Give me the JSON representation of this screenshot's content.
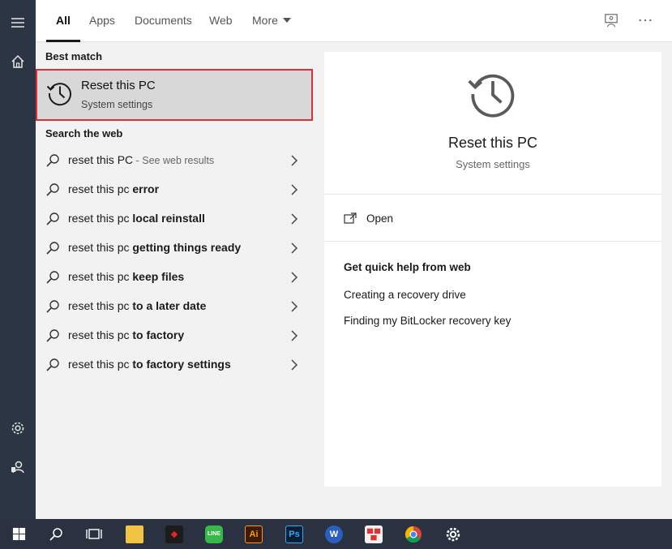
{
  "tabs": [
    {
      "label": "All",
      "active": true
    },
    {
      "label": "Apps",
      "active": false
    },
    {
      "label": "Documents",
      "active": false
    },
    {
      "label": "Web",
      "active": false
    },
    {
      "label": "More",
      "active": false
    }
  ],
  "top_icons": [
    "feedback-icon",
    "more-options-icon"
  ],
  "results": {
    "best_match_heading": "Best match",
    "best_match": {
      "title": "Reset this PC",
      "subtitle": "System settings",
      "icon": "history-icon"
    },
    "web_heading": "Search the web",
    "web_items": [
      {
        "prefix": "reset this PC",
        "bold": "",
        "hint": " - See web results"
      },
      {
        "prefix": "reset this pc ",
        "bold": "error",
        "hint": ""
      },
      {
        "prefix": "reset this pc ",
        "bold": "local reinstall",
        "hint": ""
      },
      {
        "prefix": "reset this pc ",
        "bold": "getting things ready",
        "hint": ""
      },
      {
        "prefix": "reset this pc ",
        "bold": "keep files",
        "hint": ""
      },
      {
        "prefix": "reset this pc ",
        "bold": "to a later date",
        "hint": ""
      },
      {
        "prefix": "reset this pc ",
        "bold": "to factory",
        "hint": ""
      },
      {
        "prefix": "reset this pc ",
        "bold": "to factory settings",
        "hint": ""
      }
    ]
  },
  "preview": {
    "title": "Reset this PC",
    "subtitle": "System settings",
    "open_label": "Open",
    "help_heading": "Get quick help from web",
    "links": [
      "Creating a recovery drive",
      "Finding my BitLocker recovery key"
    ]
  },
  "search": {
    "value": "reset this PC"
  },
  "left_rail": [
    "menu-icon",
    "home-icon",
    "settings-icon",
    "user-icon"
  ],
  "taskbar": {
    "items": [
      {
        "name": "start-icon"
      },
      {
        "name": "search-icon"
      },
      {
        "name": "task-view-icon"
      },
      {
        "name": "file-explorer-icon"
      },
      {
        "name": "garena-icon"
      },
      {
        "name": "line-app-icon",
        "text": "LINE"
      },
      {
        "name": "illustrator-icon",
        "text": "Ai"
      },
      {
        "name": "photoshop-icon",
        "text": "Ps"
      },
      {
        "name": "word-icon",
        "text": "W"
      },
      {
        "name": "keyboard-app-icon"
      },
      {
        "name": "chrome-icon"
      },
      {
        "name": "settings-gear-icon"
      }
    ]
  },
  "colors": {
    "highlight_border": "#d9303c",
    "rail_bg": "#2b3543",
    "taskbar_bg": "#2a3140",
    "selected_bg": "#d8d8d8"
  }
}
